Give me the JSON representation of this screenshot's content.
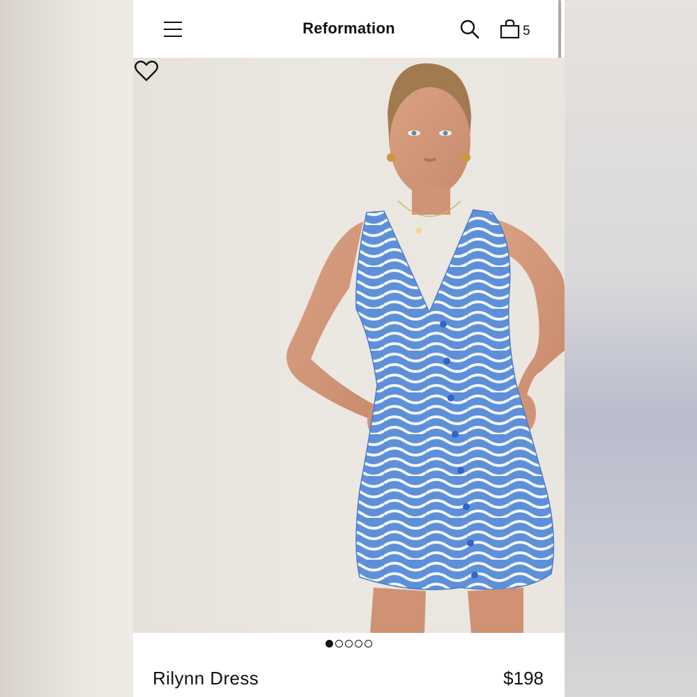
{
  "header": {
    "brand": "Reformation",
    "bag_count": "5",
    "menu_icon": "hamburger-menu-icon",
    "search_icon": "search-icon",
    "bag_icon": "shopping-bag-icon"
  },
  "gallery": {
    "favorite_icon": "heart-icon",
    "current_image": 1,
    "image_count": 5,
    "image_description": "product photo"
  },
  "product": {
    "name": "Rilynn Dress",
    "price": "$198"
  },
  "colors": {
    "dress_blue": "#5d8fd8",
    "background": "#ebe7e1",
    "text": "#111111"
  }
}
